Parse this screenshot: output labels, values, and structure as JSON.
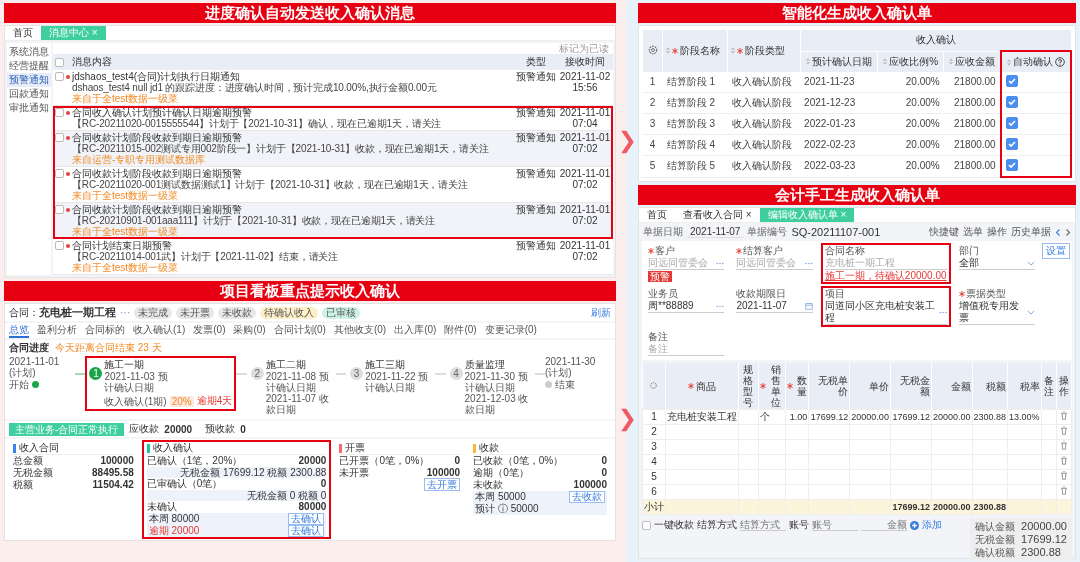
{
  "message_center": {
    "title": "进度确认自动发送收入确认消息",
    "tabs": [
      {
        "label": "首页",
        "selected": false
      },
      {
        "label": "消息中心 ×",
        "selected": true
      }
    ],
    "sidebar": [
      {
        "label": "系统消息",
        "selected": false
      },
      {
        "label": "经营提醒",
        "selected": false
      },
      {
        "label": "预警通知",
        "selected": true
      },
      {
        "label": "回款通知",
        "selected": false
      },
      {
        "label": "审批通知",
        "selected": false
      }
    ],
    "mark_read": "标记为已读",
    "select_all_checked": false,
    "columns": [
      "消息内容",
      "类型",
      "接收时间"
    ],
    "groups": [
      {
        "highlighted": false,
        "messages": [
          {
            "checked": false,
            "title": "jdshaos_test4(合同)计划执行日期通知",
            "detail": "dshaos_test4 null jd1 的跟踪进度：进度确认时间，预计完成10.00%,执行金额0.00元",
            "source": "来自于全test数据一级菜",
            "type": "预警通知",
            "time": "2021-11-02 15:56"
          }
        ]
      },
      {
        "highlighted": true,
        "messages": [
          {
            "checked": false,
            "title": "合同收入确认计划预计确认日期逾期预警",
            "detail": "【RC-20211020-0015555544】计划于【2021-10-31】确认，现在已逾期1天，请关注",
            "type": "预警通知",
            "time": "2021-11-01 07:04"
          },
          {
            "checked": false,
            "title": "合同收款计划阶段收款到期日逾期预警",
            "detail": "【RC-20211015-002测试专用002阶段一】计划于【2021-10-31】收款，现在已逾期1天，请关注",
            "source": "来自运营-专职专用测试数据库",
            "type": "预警通知",
            "time": "2021-11-01 07:02"
          },
          {
            "checked": false,
            "title": "合同收款计划阶段收款到期日逾期预警",
            "detail": "【RC-20211020-001测试数据测试1】计划于【2021-10-31】收款，现在已逾期1天，请关注",
            "source": "来自于全test数据一级菜",
            "type": "预警通知",
            "time": "2021-11-01 07:02"
          },
          {
            "checked": false,
            "title": "合同收款计划阶段收款到期日逾期预警",
            "detail": "【RC-20210901-001aaa111】计划于【2021-10-31】收款，现在已逾期1天，请关注",
            "source": "来自于全test数据一级菜",
            "type": "预警通知",
            "time": "2021-11-01 07:02"
          }
        ]
      },
      {
        "highlighted": false,
        "messages": [
          {
            "checked": false,
            "title": "合同计划结束日期预警",
            "detail": "【RC-20211014-001武】计划于【2021-11-02】结束，请关注",
            "source": "来自于全test数据一级菜",
            "type": "预警通知",
            "time": "2021-11-01 07:02"
          }
        ]
      }
    ]
  },
  "stage_table": {
    "title": "智能化生成收入确认单",
    "header": {
      "name": "阶段名称",
      "type": "阶段类型",
      "group": "收入确认",
      "sub": [
        {
          "label": "预计确认日期",
          "highlighted": false,
          "help": false
        },
        {
          "label": "应收比例%",
          "highlighted": false,
          "help": false
        },
        {
          "label": "应收金额",
          "highlighted": false,
          "help": false
        },
        {
          "label": "自动确认",
          "highlighted": true,
          "help": true
        }
      ]
    },
    "rows": [
      {
        "no": "1",
        "name": "结算阶段 1",
        "type": "收入确认阶段",
        "date": "2021-11-23",
        "ratio": "20.00%",
        "amount": "21800.00",
        "auto_confirm": true
      },
      {
        "no": "2",
        "name": "结算阶段 2",
        "type": "收入确认阶段",
        "date": "2021-12-23",
        "ratio": "20.00%",
        "amount": "21800.00",
        "auto_confirm": true
      },
      {
        "no": "3",
        "name": "结算阶段 3",
        "type": "收入确认阶段",
        "date": "2022-01-23",
        "ratio": "20.00%",
        "amount": "21800.00",
        "auto_confirm": true
      },
      {
        "no": "4",
        "name": "结算阶段 4",
        "type": "收入确认阶段",
        "date": "2022-02-23",
        "ratio": "20.00%",
        "amount": "21800.00",
        "auto_confirm": true
      },
      {
        "no": "5",
        "name": "结算阶段 5",
        "type": "收入确认阶段",
        "date": "2022-03-23",
        "ratio": "20.00%",
        "amount": "21800.00",
        "auto_confirm": true
      }
    ]
  },
  "project_board": {
    "title": "项目看板重点提示收入确认",
    "contract_label": "合同：",
    "contract_name": "充电桩一期工程",
    "more": "···",
    "tags": [
      {
        "label": "未完成",
        "color": "#e8e8e8"
      },
      {
        "label": "未开票",
        "color": "#e8e8e8"
      },
      {
        "label": "未收款",
        "color": "#e8e8e8"
      },
      {
        "label": "待确认收入",
        "color": "#fdf0c8"
      },
      {
        "label": "已审核",
        "color": "#cdf3e6"
      }
    ],
    "refresh": "刷新",
    "tabs": [
      {
        "label": "总览",
        "selected": true
      },
      {
        "label": "盈利分析",
        "selected": false
      },
      {
        "label": "合同标的",
        "selected": false
      },
      {
        "label": "收入确认(1)",
        "selected": false
      },
      {
        "label": "发票(0)",
        "selected": false
      },
      {
        "label": "采购(0)",
        "selected": false
      },
      {
        "label": "合同计划(0)",
        "selected": false
      },
      {
        "label": "其他收支(0)",
        "selected": false
      },
      {
        "label": "出入库(0)",
        "selected": false
      },
      {
        "label": "附件(0)",
        "selected": false
      },
      {
        "label": "变更记录(0)",
        "selected": false
      }
    ],
    "progress_title": "合同进度",
    "countdown": "今天距离合同结束 23 天",
    "start": {
      "date": "2021-11-01 (计划)",
      "label": "开始",
      "done": true
    },
    "steps": [
      {
        "number": "1",
        "name": "施工一期",
        "lines": [
          "2021-11-03 预计确认日期"
        ],
        "done": true,
        "highlighted": true,
        "sub": {
          "label": "收入确认(1期)",
          "percent": "20%",
          "overdue": "逾期4天"
        }
      },
      {
        "number": "2",
        "name": "施工二期",
        "lines": [
          "2021-11-08 预计确认日期",
          "2021-11-07 收款日期"
        ],
        "done": false,
        "highlighted": false
      },
      {
        "number": "3",
        "name": "施工三期",
        "lines": [
          "2021-11-22 预计确认日期"
        ],
        "done": false,
        "highlighted": false
      },
      {
        "number": "4",
        "name": "质量监理",
        "lines": [
          "2021-11-30 预计确认日期",
          "2021-12-03 收款日期"
        ],
        "done": false,
        "highlighted": false
      }
    ],
    "end": {
      "date": "2021-11-30 (计划)",
      "label": "结束",
      "done": false
    },
    "status": "主营业务-合同正常执行",
    "receivable_label": "应收款",
    "receivable": "20000",
    "prepaid_label": "预收款",
    "prepaid": "0",
    "cards": [
      {
        "title": "收入合同",
        "color": "#3b82f6",
        "highlighted": false,
        "rows": [
          {
            "kind": "stat",
            "label": "总金额",
            "value": "100000"
          },
          {
            "kind": "stat",
            "label": "无税金额",
            "value": "88495.58"
          },
          {
            "kind": "stat",
            "label": "税额",
            "value": "11504.42"
          }
        ]
      },
      {
        "title": "收入确认",
        "color": "#22c1a0",
        "highlighted": true,
        "rows": [
          {
            "kind": "stat",
            "label": "已确认（1笔，20%）",
            "value": "20000"
          },
          {
            "kind": "note",
            "text": "无税金额 17699.12 税额 2300.88"
          },
          {
            "kind": "stat",
            "label": "已审确认（0笔）",
            "value": "0"
          },
          {
            "kind": "note",
            "text": "无税金额 0 税额 0"
          },
          {
            "kind": "stat",
            "label": "未确认",
            "value": "80000"
          },
          {
            "kind": "box",
            "lines": [
              {
                "text": "本周 80000",
                "alert": false,
                "button": "去确认"
              },
              {
                "text": "逾期 20000",
                "alert": true,
                "button": "去确认"
              }
            ]
          }
        ]
      },
      {
        "title": "开票",
        "color": "#f26b6b",
        "highlighted": false,
        "rows": [
          {
            "kind": "stat",
            "label": "已开票（0笔，0%）",
            "value": "0"
          },
          {
            "kind": "stat",
            "label": "未开票",
            "value": "100000"
          },
          {
            "kind": "button",
            "label": "去开票"
          }
        ]
      },
      {
        "title": "收款",
        "color": "#f5b83d",
        "highlighted": false,
        "rows": [
          {
            "kind": "stat",
            "label": "已收款（0笔，0%）",
            "value": "0"
          },
          {
            "kind": "stat",
            "label": "逾期（0笔）",
            "value": "0"
          },
          {
            "kind": "stat",
            "label": "未收款",
            "value": "100000"
          },
          {
            "kind": "box",
            "lines": [
              {
                "text": "本周 50000",
                "alert": false,
                "button": "去收款"
              },
              {
                "text": "预计 ⓘ 50000",
                "alert": false
              }
            ]
          }
        ]
      }
    ]
  },
  "confirmation_form": {
    "title": "会计手工生成收入确认单",
    "tabs": [
      {
        "label": "首页",
        "selected": false
      },
      {
        "label": "查看收入合同 ×",
        "selected": false
      },
      {
        "label": "编辑收入确认单 ×",
        "selected": true
      }
    ],
    "doc_date_label": "单据日期",
    "doc_date": "2021-11-07",
    "doc_no_label": "单据编号",
    "doc_no": "SQ-20211107-001",
    "tools": [
      "快捷键",
      "选单",
      "操作",
      "历史单据"
    ],
    "settings": "设置",
    "fields": [
      {
        "label": "客户",
        "required": true,
        "value": "同远同管委会",
        "kind": "lookup",
        "disabled": true,
        "tag": "预警",
        "highlighted": false
      },
      {
        "label": "结算客户",
        "required": true,
        "value": "同远同管委会",
        "kind": "lookup",
        "disabled": true,
        "highlighted": false
      },
      {
        "label": "合同名称",
        "required": false,
        "value": "充电桩一期工程",
        "kind": "text",
        "disabled": true,
        "link": "施工一期，待确认20000.00",
        "highlighted": true
      },
      {
        "label": "部门",
        "required": false,
        "value": "全部",
        "kind": "select",
        "disabled": false,
        "highlighted": false
      },
      {
        "label": "业务员",
        "required": false,
        "value": "周**88889",
        "kind": "lookup",
        "disabled": false,
        "highlighted": false
      },
      {
        "label": "收款期限日",
        "required": false,
        "value": "2021-11-07",
        "kind": "date",
        "disabled": false,
        "highlighted": false
      },
      {
        "label": "项目",
        "required": false,
        "value": "同道同小区充电桩安装工程",
        "kind": "lookup",
        "disabled": false,
        "highlighted": true
      },
      {
        "label": "票据类型",
        "required": true,
        "value": "增值税专用发票",
        "kind": "select",
        "disabled": false,
        "highlighted": false
      },
      {
        "label": "备注",
        "required": false,
        "placeholder": "备注",
        "kind": "text",
        "highlighted": false
      }
    ],
    "columns": [
      {
        "label": "商品",
        "required": true,
        "kind": "text"
      },
      {
        "label": "规格型号",
        "required": false,
        "kind": "text"
      },
      {
        "label": "销售单位",
        "required": true,
        "kind": "text"
      },
      {
        "label": "数量",
        "required": true,
        "kind": "number"
      },
      {
        "label": "无税单价",
        "required": false,
        "kind": "number"
      },
      {
        "label": "单价",
        "required": false,
        "kind": "number"
      },
      {
        "label": "无税金额",
        "required": false,
        "kind": "number",
        "subtotal": "17699.12"
      },
      {
        "label": "金额",
        "required": false,
        "kind": "number",
        "subtotal": "20000.00"
      },
      {
        "label": "税额",
        "required": false,
        "kind": "number",
        "subtotal": "2300.88"
      },
      {
        "label": "税率",
        "required": false,
        "kind": "number"
      },
      {
        "label": "备注",
        "required": false,
        "kind": "text"
      }
    ],
    "action_label": "操作",
    "rows": [
      {
        "no": "1",
        "cells": [
          "充电桩安装工程",
          null,
          "个",
          "1.00",
          "17699.12",
          "20000.00",
          "17699.12",
          "20000.00",
          "2300.88",
          "13.00%",
          null
        ]
      },
      {
        "no": "2"
      },
      {
        "no": "3"
      },
      {
        "no": "4"
      },
      {
        "no": "5"
      },
      {
        "no": "6"
      }
    ],
    "subtotal_label": "小计",
    "one_click": {
      "label": "一键收款",
      "checked": false
    },
    "settlement": {
      "label": "结算方式",
      "placeholder": "结算方式"
    },
    "account": {
      "label": "账号",
      "placeholder": "账号"
    },
    "amount": {
      "placeholder": "金额"
    },
    "add": "添加",
    "summary": [
      {
        "label": "确认金额",
        "value": "20000.00"
      },
      {
        "label": "无税金额",
        "value": "17699.12"
      },
      {
        "label": "确认税额",
        "value": "2300.88"
      }
    ]
  }
}
